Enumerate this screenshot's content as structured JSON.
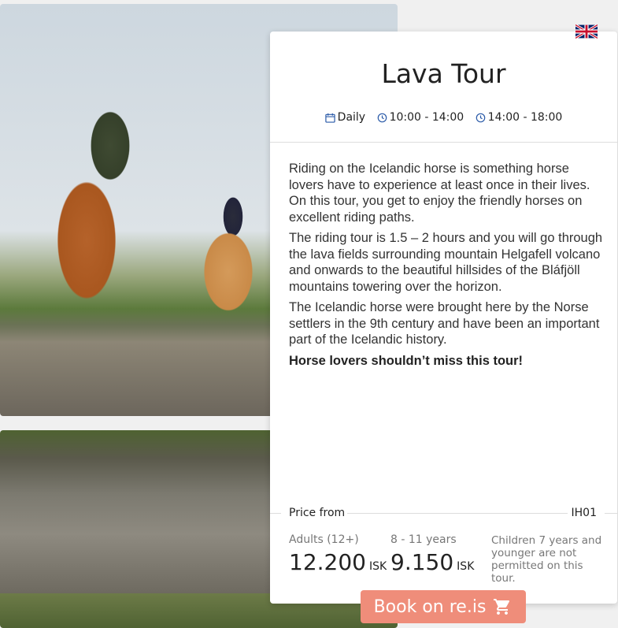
{
  "tour": {
    "title": "Lava Tour",
    "schedule": {
      "frequency": "Daily",
      "times": [
        "10:00 - 14:00",
        "14:00 - 18:00"
      ]
    },
    "description": [
      "Riding on the Icelandic horse is something horse lovers have to experience at least once in their lives. On this tour, you get to enjoy the friendly horses on excellent riding paths.",
      "The riding tour is 1.5 – 2 hours and you will go through the lava fields surrounding mountain Helgafell volcano and onwards to the beautiful hillsides of the Bláfjöll mountains towering over the horizon.",
      "The Icelandic horse were brought here by the Norse settlers in the 9th century and have been an important part of the Icelandic history."
    ],
    "highlight": "Horse lovers shouldn’t miss this tour!"
  },
  "pricing": {
    "label": "Price from",
    "code": "IH01",
    "adults": {
      "label": "Adults (12+)",
      "price": "12.200",
      "currency": "ISK"
    },
    "kids": {
      "label": "8 - 11 years",
      "price": "9.150",
      "currency": "ISK"
    },
    "note": "Children 7 years and younger are not permitted on this tour."
  },
  "booking": {
    "label": "Book on re.is",
    "icon": "cart-icon"
  },
  "language": {
    "icon": "uk-flag-icon"
  },
  "colors": {
    "button": "#ef8d7a",
    "icon_blue": "#2a5aa8"
  }
}
